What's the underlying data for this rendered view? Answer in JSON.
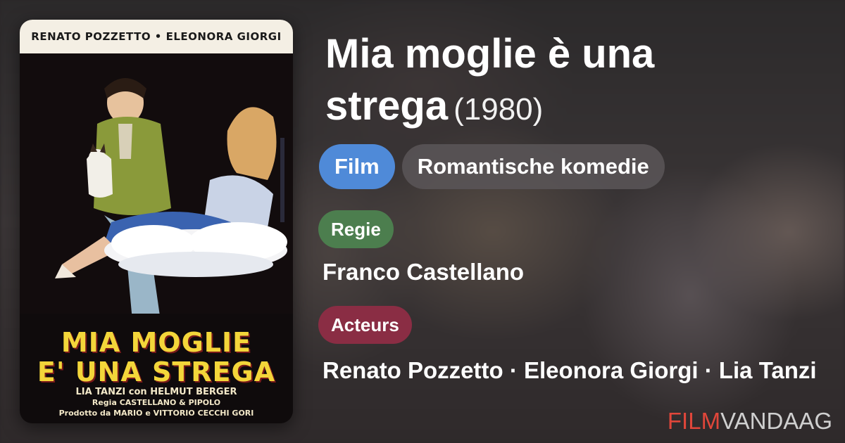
{
  "poster": {
    "top_credits": "RENATO POZZETTO • ELEONORA GIORGI",
    "title_line1": "MIA MOGLIE",
    "title_line2": "E' UNA STREGA",
    "credit_line1": "LIA TANZI con HELMUT BERGER",
    "credit_line2": "Regia CASTELLANO & PIPOLO",
    "credit_line3": "Prodotto da MARIO e VITTORIO CECCHI GORI"
  },
  "movie": {
    "title": "Mia moglie è una strega",
    "year": "(1980)",
    "type_tag": "Film",
    "genre_tag": "Romantische komedie"
  },
  "sections": {
    "director_label": "Regie",
    "director_value": "Franco Castellano",
    "actors_label": "Acteurs",
    "actors_value": "Renato Pozzetto · Eleonora Giorgi · Lia Tanzi"
  },
  "brand": {
    "part1": "FILM",
    "part2": "VANDAAG"
  },
  "colors": {
    "type_tag": "#4f8ad8",
    "director_label": "#4c7e4e",
    "actors_label": "#8a2d44",
    "brand_accent": "#e0463a"
  }
}
